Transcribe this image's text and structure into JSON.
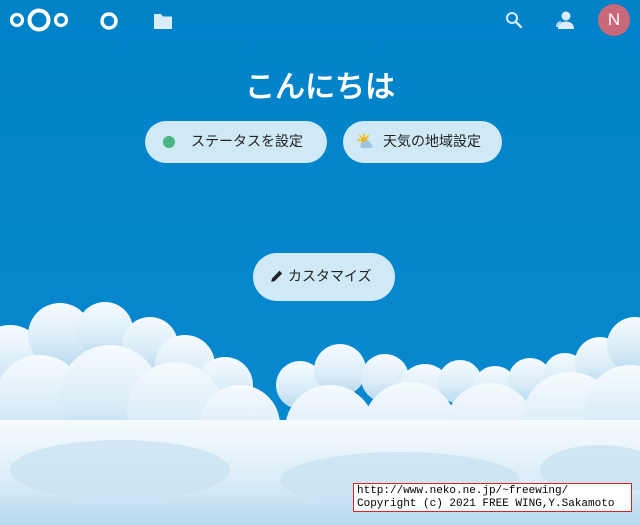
{
  "greeting": "こんにちは",
  "buttons": {
    "status": "ステータスを設定",
    "weather": "天気の地域設定",
    "customize": "カスタマイズ"
  },
  "header": {
    "user_initial": "N",
    "icons": [
      "nextcloud-logo-icon",
      "dashboard-icon",
      "files-icon",
      "search-icon",
      "contacts-icon"
    ]
  },
  "watermark": {
    "line1": "http://www.neko.ne.jp/~freewing/",
    "line2": "Copyright (c) 2021 FREE WING,Y.Sakamoto"
  },
  "colors": {
    "background": "#0082c9",
    "status_online": "#49b382",
    "avatar": "#c86878"
  }
}
